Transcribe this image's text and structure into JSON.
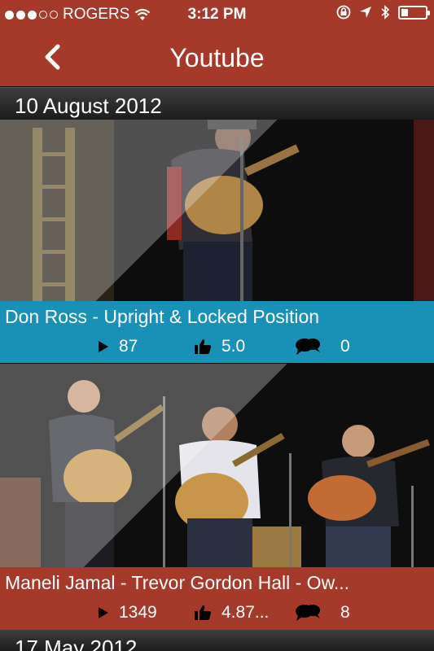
{
  "status": {
    "carrier": "ROGERS",
    "time": "3:12 PM",
    "signal_filled": 3,
    "signal_total": 5,
    "battery_level": 0.3
  },
  "nav": {
    "title": "Youtube",
    "back_icon": "chevron-left-icon"
  },
  "sections": [
    {
      "date": "10 August 2012"
    },
    {
      "date": "17 May 2012"
    }
  ],
  "videos": [
    {
      "title": "Don Ross - Upright & Locked Position",
      "views": "87",
      "rating": "5.0",
      "comments": "0",
      "bar_color": "#1990b5"
    },
    {
      "title": "Maneli Jamal - Trevor Gordon Hall - Ow...",
      "views": "1349",
      "rating": "4.87...",
      "comments": "8",
      "bar_color": "#a53a2a"
    }
  ],
  "colors": {
    "brand": "#a53a2a",
    "accent": "#1990b5"
  }
}
